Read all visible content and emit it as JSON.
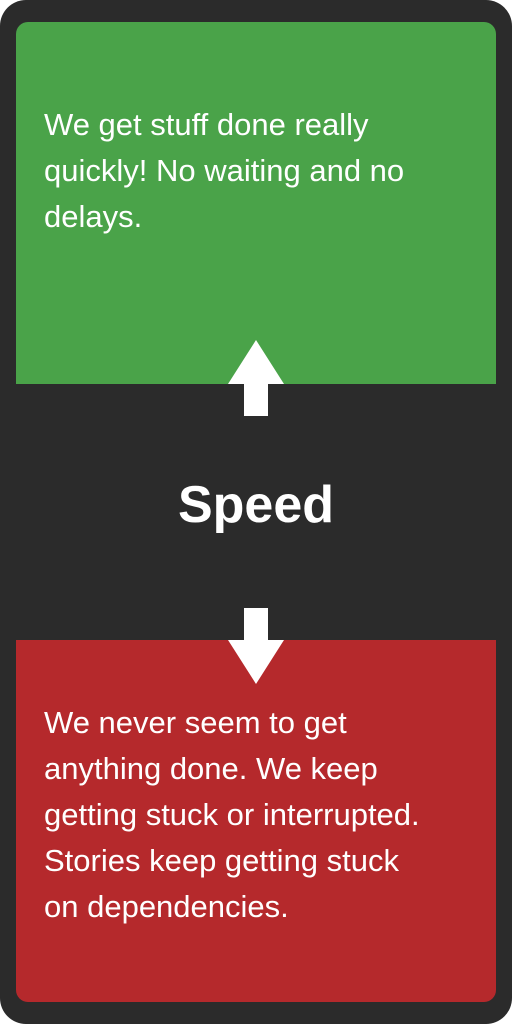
{
  "colors": {
    "background": "#2b2b2b",
    "positive": "#4aa349",
    "negative": "#b5292c",
    "text": "#ffffff"
  },
  "top_panel": {
    "text": "We get stuff done really quickly! No waiting and no delays."
  },
  "center": {
    "label": "Speed"
  },
  "bottom_panel": {
    "text": "We never seem to get anything done. We keep getting stuck or interrupted. Stories keep getting stuck on dependencies."
  },
  "icons": {
    "up": "arrow-up-icon",
    "down": "arrow-down-icon"
  }
}
